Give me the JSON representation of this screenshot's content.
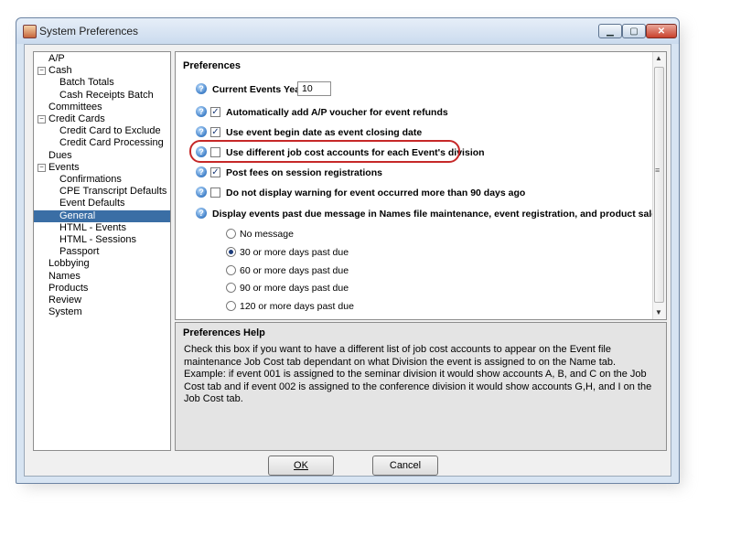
{
  "window": {
    "title": "System Preferences",
    "controls": [
      "minimize",
      "maximize",
      "close"
    ]
  },
  "tree": {
    "items": [
      {
        "label": "A/P",
        "level": 0,
        "expander": ""
      },
      {
        "label": "Cash",
        "level": 0,
        "expander": "−"
      },
      {
        "label": "Batch Totals",
        "level": 1,
        "expander": ""
      },
      {
        "label": "Cash Receipts Batch",
        "level": 1,
        "expander": ""
      },
      {
        "label": "Committees",
        "level": 0,
        "expander": ""
      },
      {
        "label": "Credit Cards",
        "level": 0,
        "expander": "−"
      },
      {
        "label": "Credit Card to Exclude",
        "level": 1,
        "expander": ""
      },
      {
        "label": "Credit Card Processing",
        "level": 1,
        "expander": ""
      },
      {
        "label": "Dues",
        "level": 0,
        "expander": ""
      },
      {
        "label": "Events",
        "level": 0,
        "expander": "−"
      },
      {
        "label": "Confirmations",
        "level": 1,
        "expander": ""
      },
      {
        "label": "CPE Transcript Defaults",
        "level": 1,
        "expander": ""
      },
      {
        "label": "Event Defaults",
        "level": 1,
        "expander": ""
      },
      {
        "label": "General",
        "level": 1,
        "expander": "",
        "selected": true
      },
      {
        "label": "HTML - Events",
        "level": 1,
        "expander": ""
      },
      {
        "label": "HTML - Sessions",
        "level": 1,
        "expander": ""
      },
      {
        "label": "Passport",
        "level": 1,
        "expander": ""
      },
      {
        "label": "Lobbying",
        "level": 0,
        "expander": ""
      },
      {
        "label": "Names",
        "level": 0,
        "expander": ""
      },
      {
        "label": "Products",
        "level": 0,
        "expander": ""
      },
      {
        "label": "Review",
        "level": 0,
        "expander": ""
      },
      {
        "label": "System",
        "level": 0,
        "expander": ""
      }
    ]
  },
  "preferences": {
    "title": "Preferences",
    "current_year_label": "Current Events Year",
    "current_year_value": "10",
    "options": [
      {
        "label": "Automatically add A/P voucher for event refunds",
        "checked": true
      },
      {
        "label": "Use event begin date as event closing date",
        "checked": true
      },
      {
        "label": "Use different job cost accounts for each Event's division",
        "checked": false,
        "highlighted": true
      },
      {
        "label": "Post fees on session registrations",
        "checked": true
      },
      {
        "label": "Do not display warning for event occurred more than 90 days ago",
        "checked": false
      }
    ],
    "past_due_label": "Display events past due message in Names file maintenance, event registration, and product sale when",
    "radio_options": [
      {
        "label": "No message",
        "selected": false
      },
      {
        "label": "30 or more days past due",
        "selected": true
      },
      {
        "label": "60 or more days past due",
        "selected": false
      },
      {
        "label": "90 or more days past due",
        "selected": false
      },
      {
        "label": "120 or more days past due",
        "selected": false
      }
    ]
  },
  "help": {
    "title": "Preferences Help",
    "text": "Check this box if you want to have a different list of job cost accounts to appear on the Event file maintenance Job Cost tab dependant on what Division the event is assigned to on the Name tab.  Example: if event 001 is assigned to the seminar division it would show accounts A, B, and C on the Job Cost tab and if event 002 is assigned to the conference division it would show accounts G,H, and I on the Job Cost tab."
  },
  "buttons": {
    "ok": "OK",
    "cancel": "Cancel"
  },
  "colors": {
    "selection": "#3a6ea5",
    "highlight_ring": "#c62828",
    "titlebar": "#d7e4f2"
  }
}
